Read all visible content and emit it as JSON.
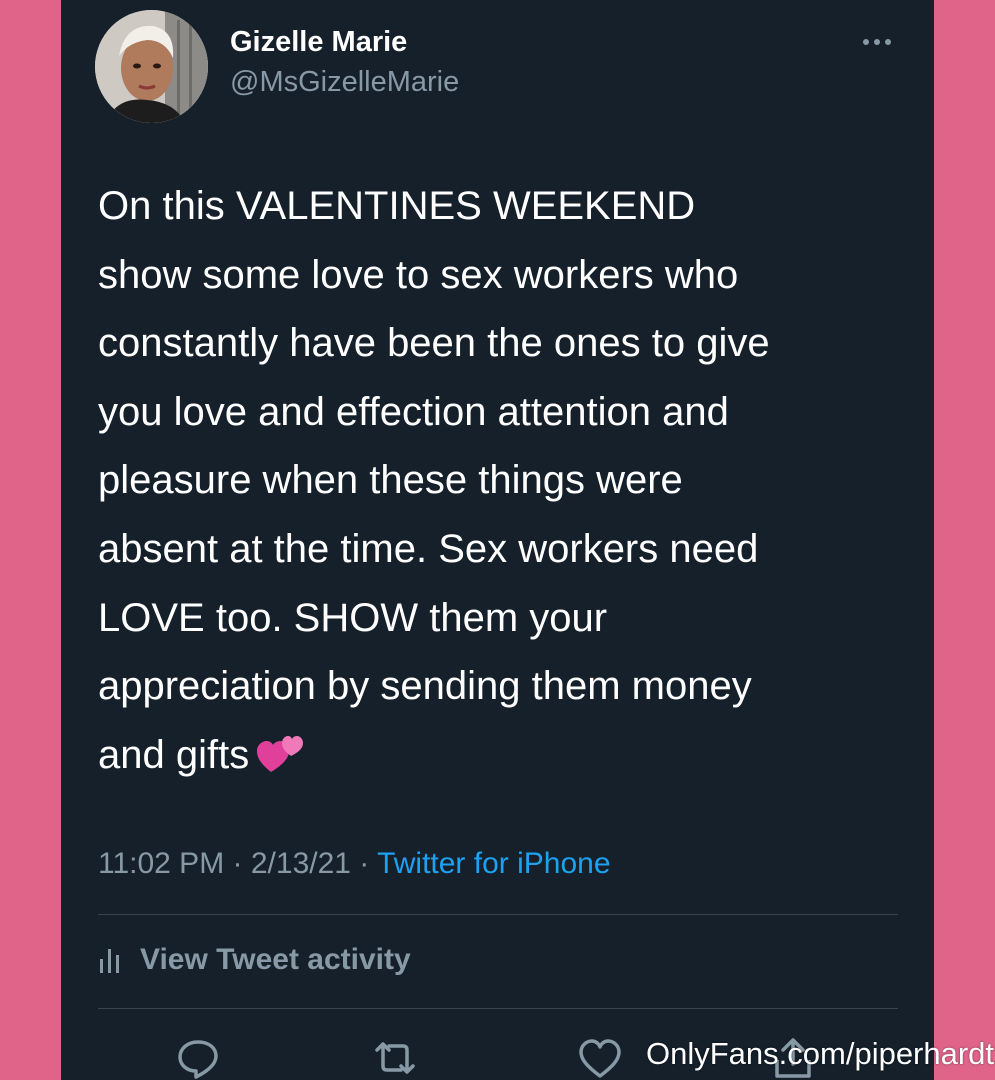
{
  "user": {
    "display_name": "Gizelle Marie",
    "handle": "@MsGizelleMarie"
  },
  "tweet": {
    "text": "On this VALENTINES WEEKEND\nshow some love to sex workers who\nconstantly have been the ones to give\nyou love and effection attention and\npleasure when these things were\nabsent at the time. Sex workers need\nLOVE too. SHOW them your\nappreciation by sending them money\nand gifts",
    "emoji": "two-hearts-emoji",
    "time": "11:02 PM",
    "date": "2/13/21",
    "separator": " · ",
    "source": "Twitter for iPhone"
  },
  "activity": {
    "label": "View Tweet activity"
  },
  "actions": {
    "icons": [
      "reply-icon",
      "retweet-icon",
      "like-icon",
      "share-icon"
    ]
  },
  "watermark": {
    "text": "OnlyFans.com/piperhardt"
  },
  "colors": {
    "background": "#e0648a",
    "card": "#15202b",
    "text_primary": "#ffffff",
    "text_secondary": "#8899a6",
    "link": "#1da1f2",
    "divider": "#38444d",
    "heart": "#e0409a"
  }
}
